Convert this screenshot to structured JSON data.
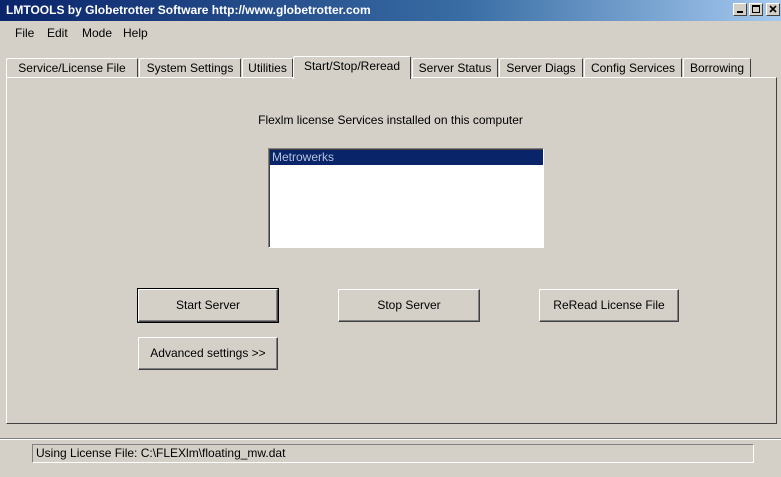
{
  "window": {
    "title": "LMTOOLS by Globetrotter Software http://www.globetrotter.com"
  },
  "menu": [
    "File",
    "Edit",
    "Mode",
    "Help"
  ],
  "tabs": [
    {
      "label": "Service/License File"
    },
    {
      "label": "System Settings"
    },
    {
      "label": "Utilities"
    },
    {
      "label": "Start/Stop/Reread",
      "active": true
    },
    {
      "label": "Server Status"
    },
    {
      "label": "Server Diags"
    },
    {
      "label": "Config Services"
    },
    {
      "label": "Borrowing"
    }
  ],
  "main": {
    "heading": "Flexlm license Services installed on this computer",
    "services": [
      {
        "name": "Metrowerks",
        "selected": true
      }
    ],
    "buttons": {
      "start": "Start Server",
      "stop": "Stop Server",
      "reread": "ReRead License File",
      "advanced": "Advanced settings >>"
    }
  },
  "status": {
    "text": "Using License File:  C:\\FLEXlm\\floating_mw.dat"
  },
  "colors": {
    "face": "#d4d0c8",
    "title_start": "#0a246a",
    "title_end": "#a6caf0",
    "selection": "#0a246a"
  }
}
